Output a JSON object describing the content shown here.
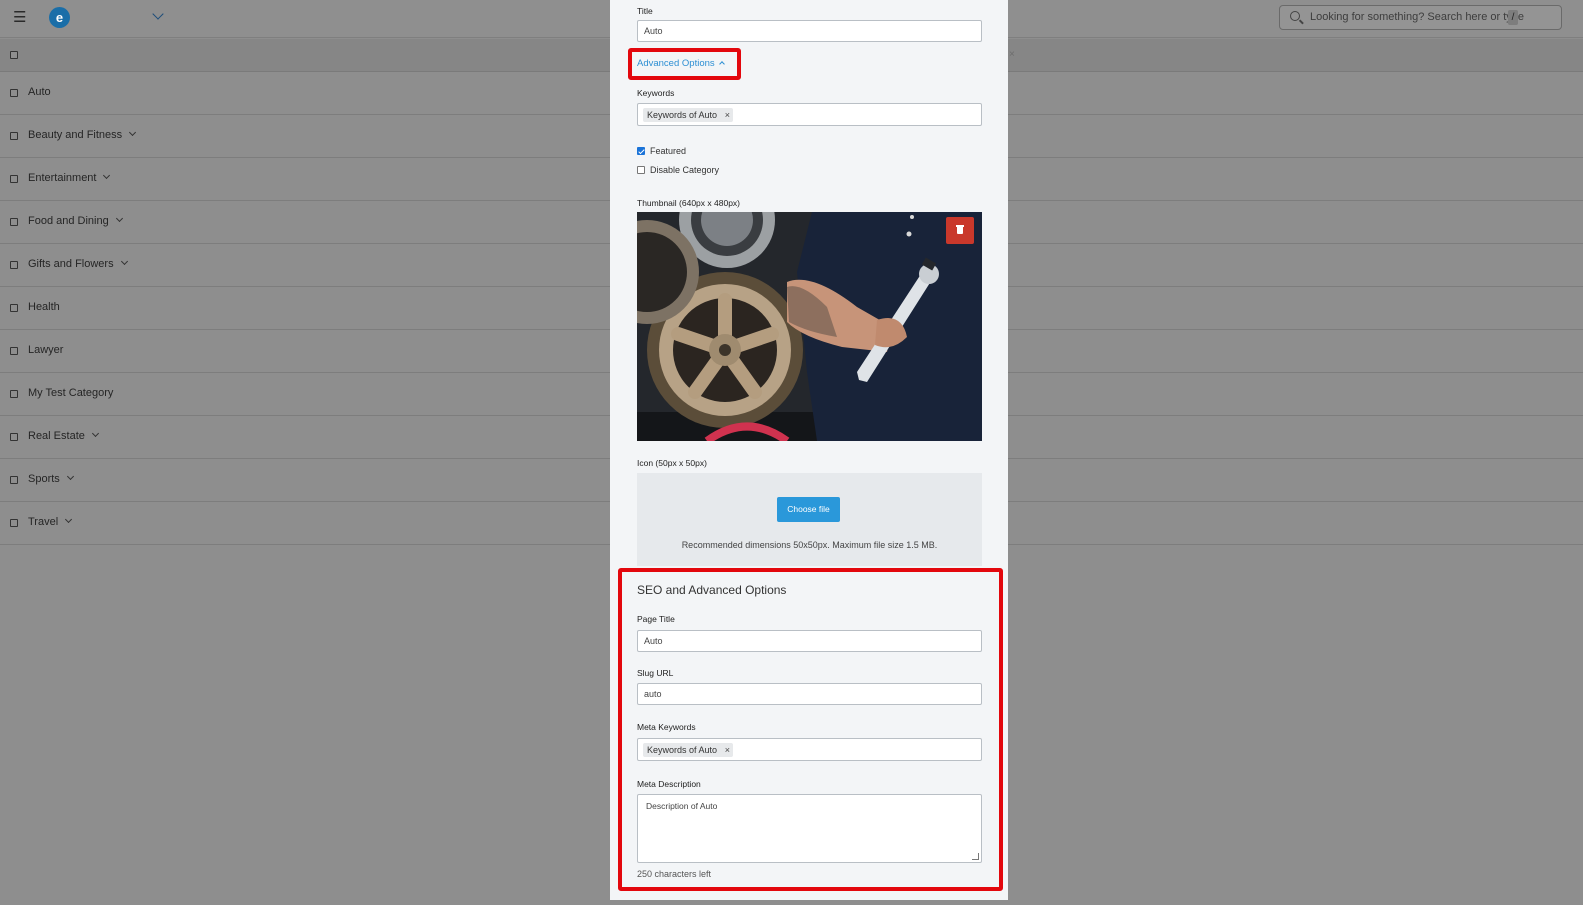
{
  "app": {
    "logo_letter": "e",
    "search_placeholder": "Looking for something? Search here or type",
    "search_shortcut": "/",
    "header_close": "×"
  },
  "categories": [
    {
      "name": "Auto",
      "has_children": false
    },
    {
      "name": "Beauty and Fitness",
      "has_children": true
    },
    {
      "name": "Entertainment",
      "has_children": true
    },
    {
      "name": "Food and Dining",
      "has_children": true
    },
    {
      "name": "Gifts and Flowers",
      "has_children": true
    },
    {
      "name": "Health",
      "has_children": false
    },
    {
      "name": "Lawyer",
      "has_children": false
    },
    {
      "name": "My Test Category",
      "has_children": false
    },
    {
      "name": "Real Estate",
      "has_children": true
    },
    {
      "name": "Sports",
      "has_children": true
    },
    {
      "name": "Travel",
      "has_children": true
    }
  ],
  "form": {
    "title_label": "Title",
    "title_value": "Auto",
    "advanced_toggle": "Advanced Options",
    "keywords_label": "Keywords",
    "keywords_tag": "Keywords of Auto",
    "tag_remove": "×",
    "featured_label": "Featured",
    "featured_checked": true,
    "disable_label": "Disable Category",
    "disable_checked": false,
    "thumbnail_label": "Thumbnail (640px x 480px)",
    "icon_label": "Icon (50px x 50px)",
    "choose_file": "Choose file",
    "recommendation": "Recommended dimensions 50x50px. Maximum file size 1.5 MB."
  },
  "seo": {
    "heading": "SEO and Advanced Options",
    "page_title_label": "Page Title",
    "page_title_value": "Auto",
    "slug_label": "Slug URL",
    "slug_value": "auto",
    "meta_keywords_label": "Meta Keywords",
    "meta_keywords_tag": "Keywords of Auto",
    "meta_description_label": "Meta Description",
    "meta_description_value": "Description of Auto",
    "chars_left": "250 characters left"
  },
  "colors": {
    "highlight": "#e3070d",
    "accent": "#2a98da",
    "danger": "#c9382b"
  }
}
